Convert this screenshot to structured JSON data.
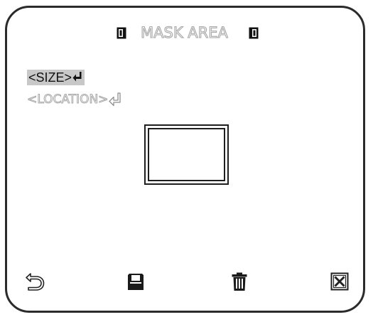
{
  "header": {
    "title": "MASK AREA",
    "prev_icon": "left-bracket-arrow-icon",
    "next_icon": "right-bracket-arrow-icon"
  },
  "menu": {
    "items": [
      {
        "label": "<SIZE>",
        "selected": true,
        "icon": "enter-icon"
      },
      {
        "label": "<LOCATION>",
        "selected": false,
        "icon": "enter-icon"
      }
    ]
  },
  "toolbar": {
    "back_icon": "back-icon",
    "save_icon": "save-icon",
    "delete_icon": "trash-icon",
    "close_icon": "close-icon"
  },
  "colors": {
    "frame": "#2b2b2b",
    "highlight": "#c8c8c8",
    "disabled_text": "#a8a8a8"
  }
}
